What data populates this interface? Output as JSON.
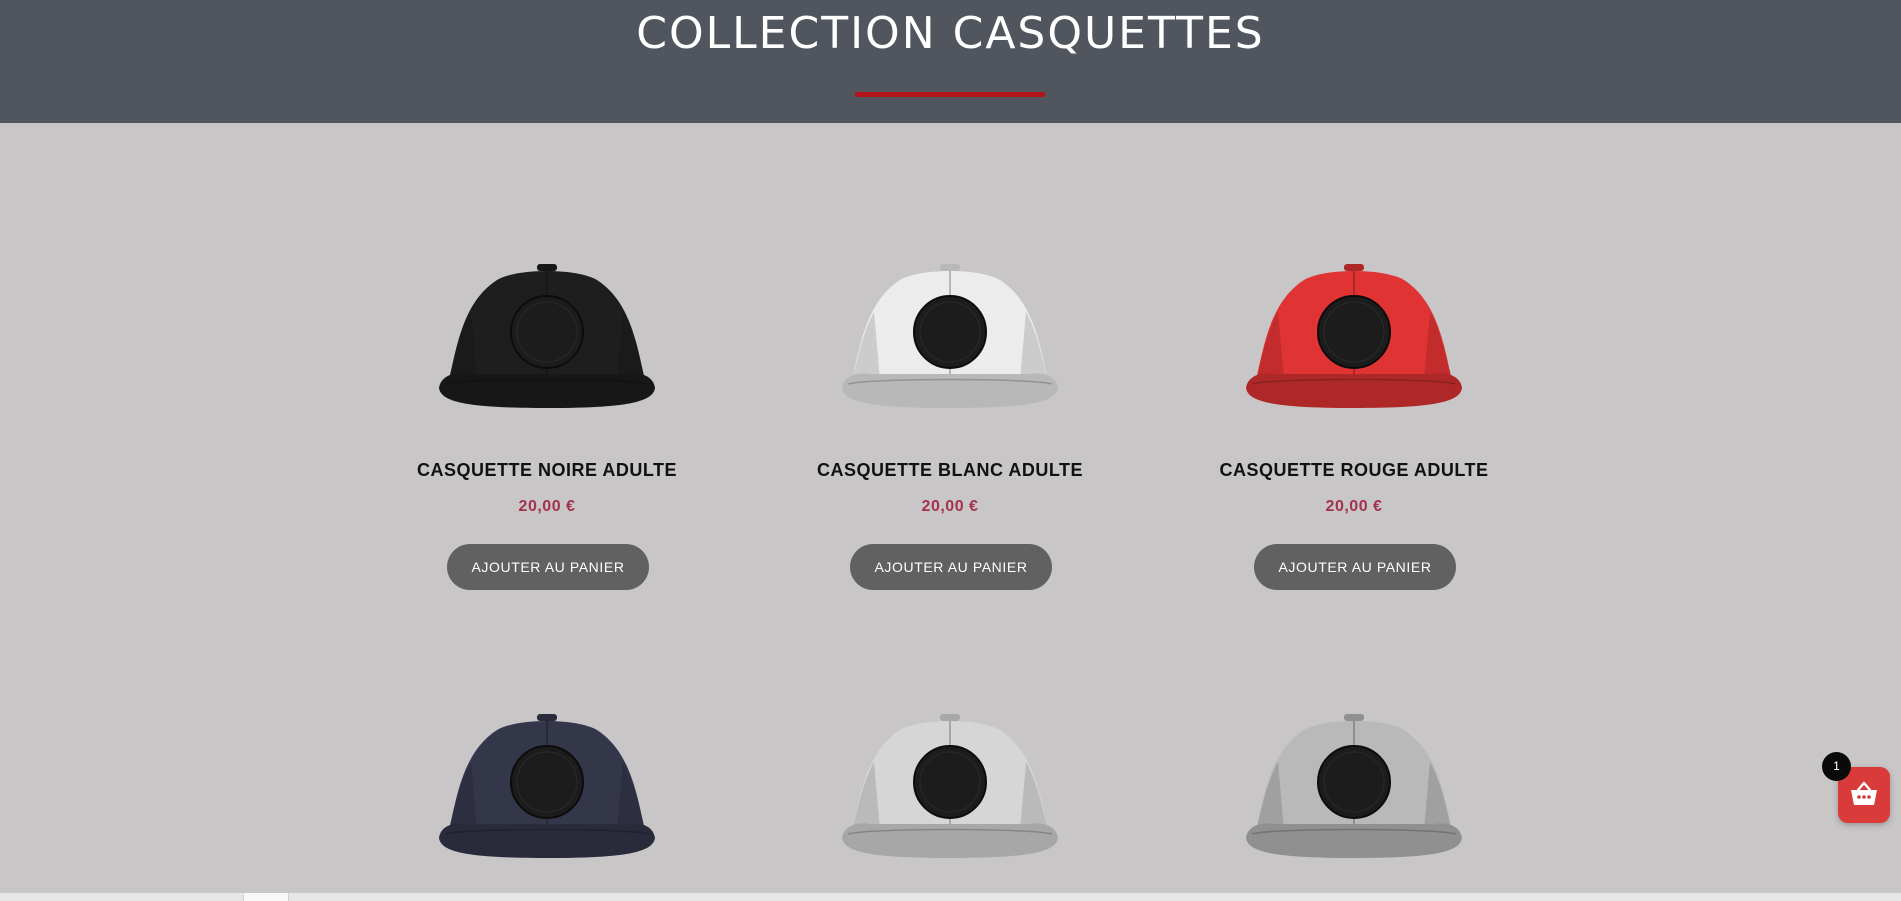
{
  "header": {
    "title": "COLLECTION CASQUETTES"
  },
  "products": [
    {
      "name": "CASQUETTE NOIRE ADULTE",
      "price": "20,00 €",
      "button": "AJOUTER AU PANIER",
      "color": "#1e1e1e"
    },
    {
      "name": "CASQUETTE BLANC ADULTE",
      "price": "20,00 €",
      "button": "AJOUTER AU PANIER",
      "color": "#ececec"
    },
    {
      "name": "CASQUETTE ROUGE ADULTE",
      "price": "20,00 €",
      "button": "AJOUTER AU PANIER",
      "color": "#e03333"
    },
    {
      "color": "#34364a"
    },
    {
      "color": "#d6d6d6"
    },
    {
      "color": "#b9b9b9"
    }
  ],
  "cart": {
    "count": "1"
  },
  "colors": {
    "accent": "#b3141b",
    "price": "#a4324e",
    "button": "#616161",
    "cart": "#d93a3a"
  }
}
